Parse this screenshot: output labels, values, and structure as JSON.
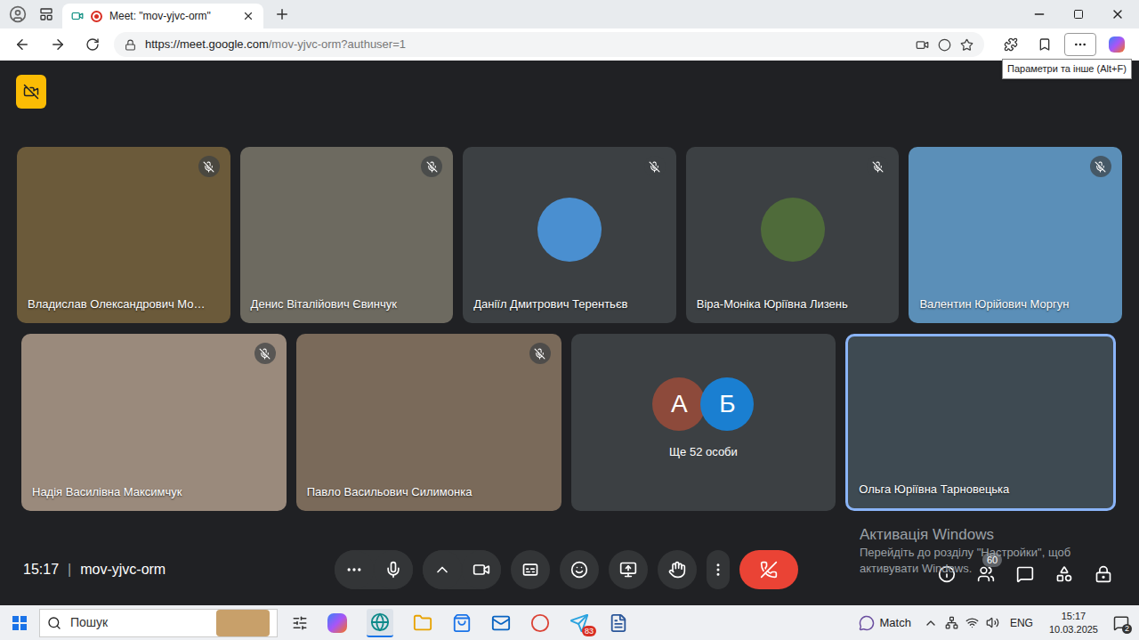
{
  "browser": {
    "tab_title": "Meet: \"mov-yjvc-orm\"",
    "url_host": "https://meet.google.com",
    "url_path": "/mov-yjvc-orm?authuser=1",
    "tooltip": "Параметри та інше (Alt+F)"
  },
  "meeting": {
    "time": "15:17",
    "separator": "|",
    "code": "mov-yjvc-orm",
    "people_count": "60"
  },
  "tiles": [
    {
      "kind": "video",
      "name": "Владислав Олександрович Мо…",
      "muted": true,
      "selected": false,
      "color": "#6b5a3a"
    },
    {
      "kind": "video",
      "name": "Денис Віталійович Євинчук",
      "muted": true,
      "selected": false,
      "color": "#6d6a60"
    },
    {
      "kind": "avatar",
      "name": "Даніїл Дмитрович Терентьєв",
      "muted": true,
      "selected": false,
      "color": "#4a8fd0"
    },
    {
      "kind": "avatar",
      "name": "Віра-Моніка Юріївна Лизень",
      "muted": true,
      "selected": false,
      "color": "#4f6b3a"
    },
    {
      "kind": "video",
      "name": "Валентин Юрійович Моргун",
      "muted": true,
      "selected": false,
      "color": "#5b8fb8"
    },
    {
      "kind": "video",
      "name": "Надія Василівна Максимчук",
      "muted": true,
      "selected": false,
      "color": "#9a8a7c"
    },
    {
      "kind": "video",
      "name": "Павло Васильович Силимонка",
      "muted": true,
      "selected": false,
      "color": "#7a6a5a"
    },
    {
      "kind": "more",
      "name": "Ще 52 особи",
      "muted": false,
      "selected": false,
      "color": "#3c4043",
      "letters": [
        {
          "letter": "А",
          "color": "#8d4a3b"
        },
        {
          "letter": "Б",
          "color": "#1a7fd1"
        }
      ]
    },
    {
      "kind": "video",
      "name": "Ольга Юріївна Тарновецька",
      "muted": false,
      "selected": true,
      "color": "#3e4a52"
    }
  ],
  "watermark": {
    "title": "Активація Windows",
    "line1": "Перейдіть до розділу \"Настройки\", щоб",
    "line2": "активувати Windows."
  },
  "taskbar": {
    "search_placeholder": "Пошук",
    "telegram_badge": "83",
    "widget_label": "Match",
    "language": "ENG",
    "time": "15:17",
    "date": "10.03.2025",
    "notifications": "2"
  }
}
